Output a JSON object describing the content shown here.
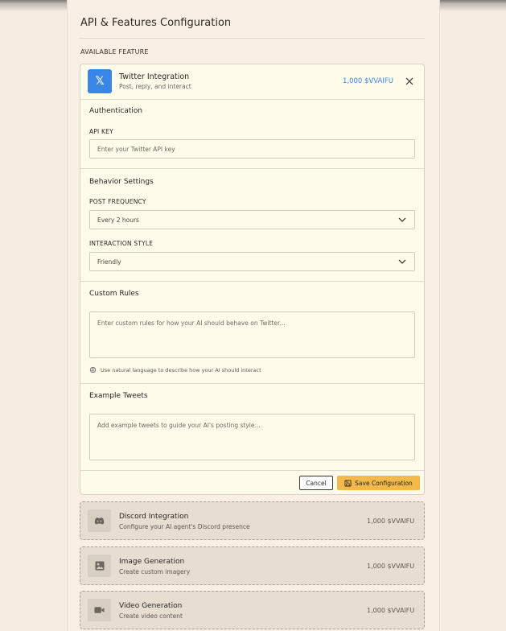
{
  "page": {
    "title": "API & Features Configuration",
    "section_label": "AVAILABLE FEATURE"
  },
  "active_feature": {
    "name": "Twitter Integration",
    "description": "Post, reply, and interact",
    "price": "1,000 $VVAIFU",
    "icon": "x-logo-icon",
    "icon_glyph": "𝕏",
    "accent_color": "#3a86e6"
  },
  "authentication": {
    "title": "Authentication",
    "api_key_label": "API KEY",
    "api_key_value": "",
    "api_key_placeholder": "Enter your Twitter API key"
  },
  "behavior": {
    "title": "Behavior Settings",
    "post_frequency_label": "POST FREQUENCY",
    "post_frequency_value": "Every 2 hours",
    "interaction_style_label": "INTERACTION STYLE",
    "interaction_style_value": "Friendly"
  },
  "custom_rules": {
    "title": "Custom Rules",
    "placeholder": "Enter custom rules for how your AI should behave on Twitter...",
    "hint": "Use natural language to describe how your AI should interact"
  },
  "example_tweets": {
    "title": "Example Tweets",
    "placeholder": "Add example tweets to guide your AI's posting style..."
  },
  "actions": {
    "cancel_label": "Cancel",
    "save_label": "Save Configuration",
    "save_color": "#f3b94a"
  },
  "other_features": [
    {
      "name": "Discord Integration",
      "description": "Configure your AI agent's Discord presence",
      "price": "1,000 $VVAIFU",
      "icon": "discord-icon"
    },
    {
      "name": "Image Generation",
      "description": "Create custom imagery",
      "price": "1,000 $VVAIFU",
      "icon": "image-icon"
    },
    {
      "name": "Video Generation",
      "description": "Create video content",
      "price": "1,000 $VVAIFU",
      "icon": "video-camera-icon"
    }
  ]
}
